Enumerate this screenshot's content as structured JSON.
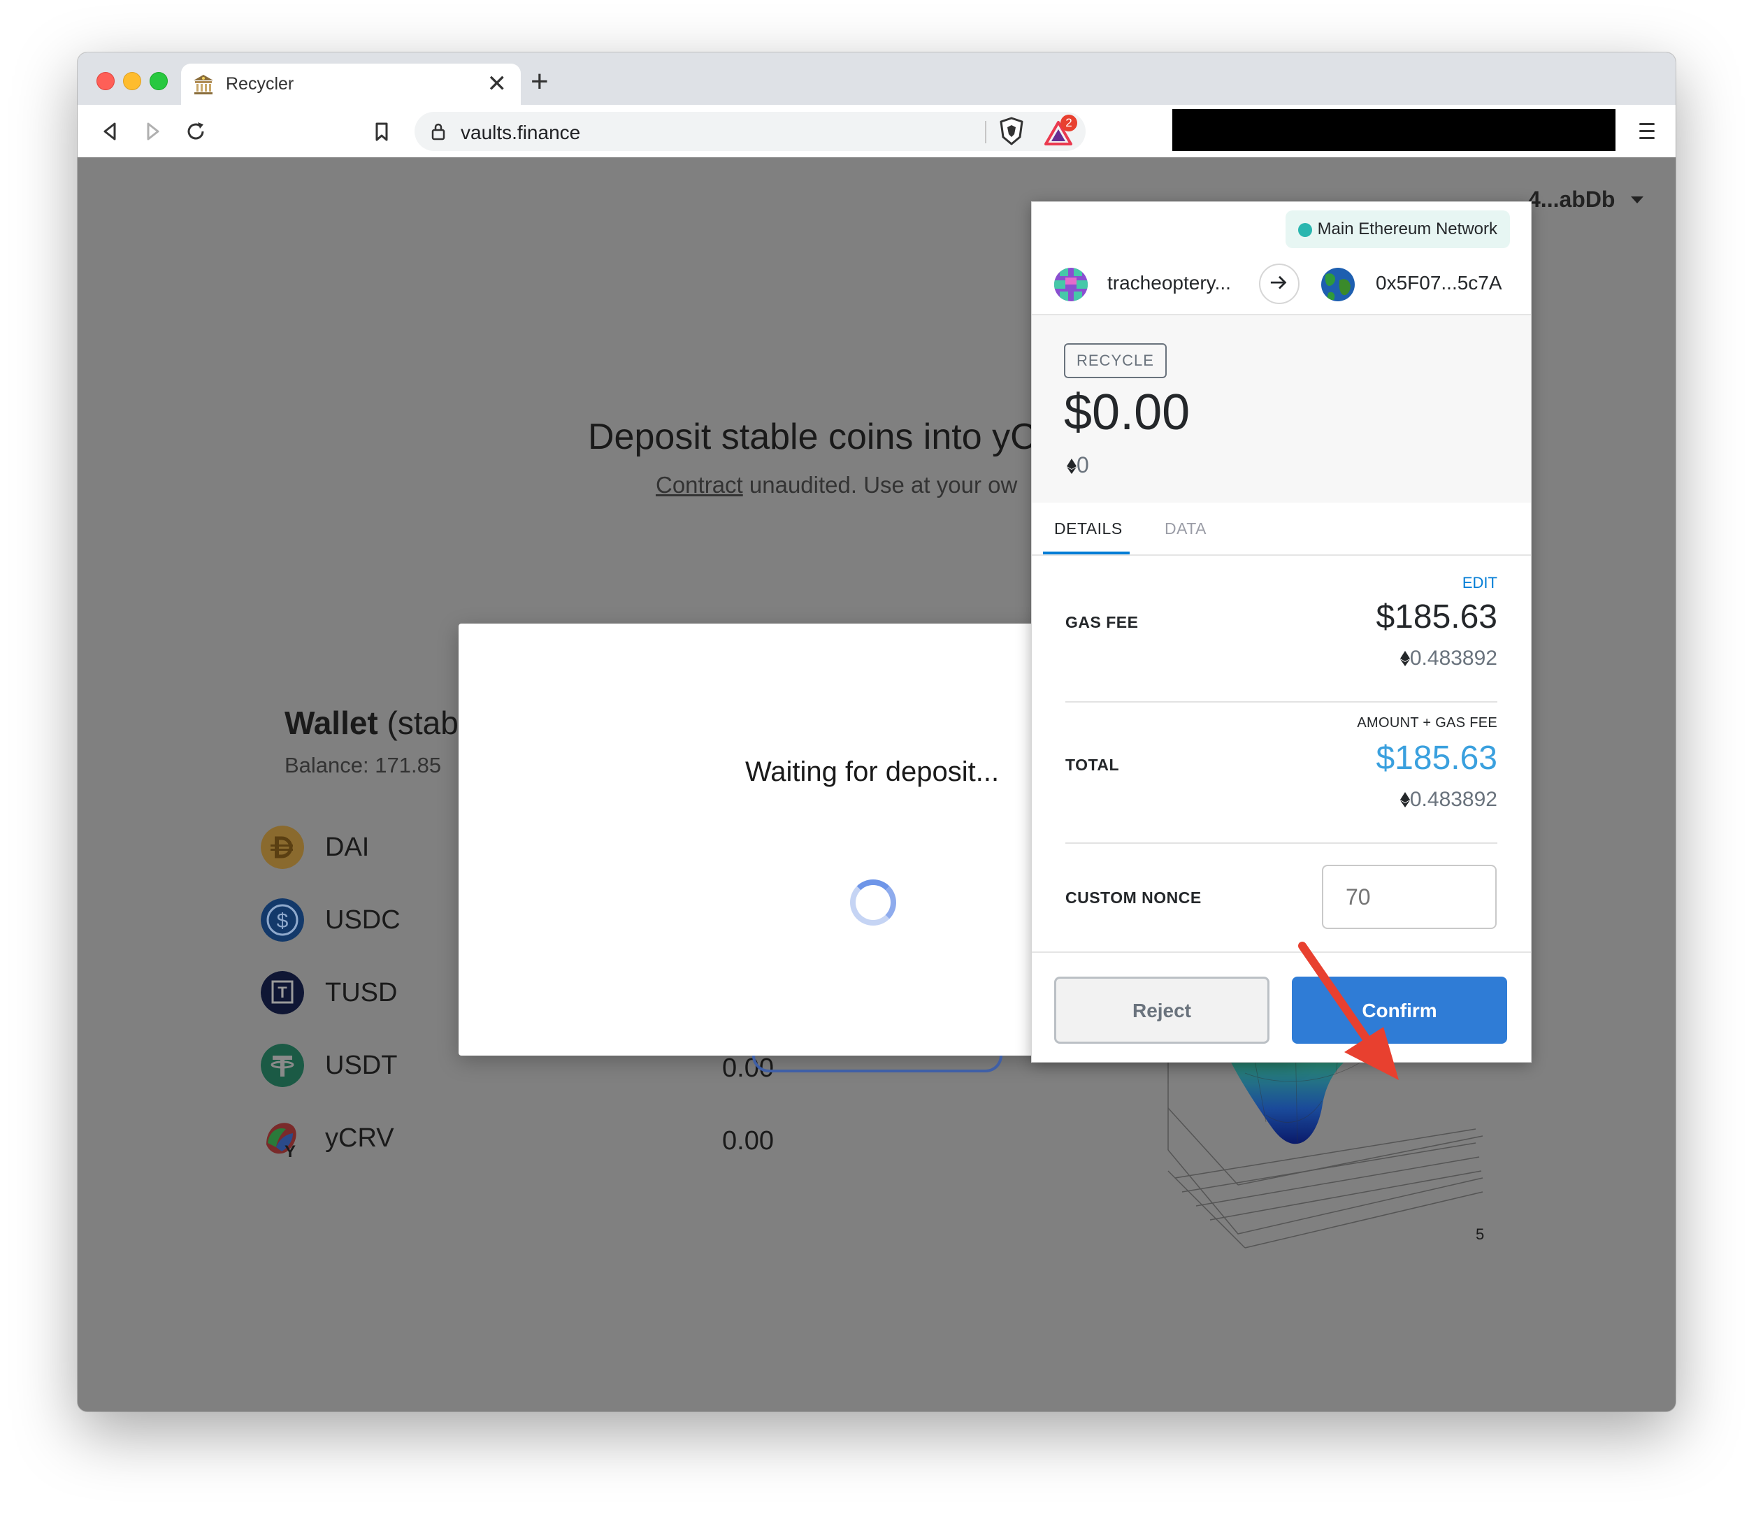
{
  "browser": {
    "tab_title": "Recycler",
    "tab_close": "✕",
    "new_tab": "+",
    "url": "vaults.finance",
    "shield_badge_count": "2"
  },
  "page": {
    "account": "4...abDb",
    "title": "Deposit stable coins into yC",
    "subtitle_link": "Contract",
    "subtitle_rest": " unaudited. Use at your ow",
    "wallet_title_bold": "Wallet",
    "wallet_title_rest": " (stab",
    "wallet_balance": "Balance: 171.85",
    "coins": [
      {
        "name": "DAI",
        "value": "",
        "color": "#f5ac37"
      },
      {
        "name": "USDC",
        "value": "",
        "color": "#2775ca"
      },
      {
        "name": "TUSD",
        "value": "",
        "color": "#1a2a6c"
      },
      {
        "name": "USDT",
        "value": "0.00",
        "color": "#26a17b"
      },
      {
        "name": "yCRV",
        "value": "0.00",
        "color": "#e84142"
      }
    ],
    "plot_tick": "5"
  },
  "modal": {
    "status": "Waiting for deposit..."
  },
  "metamask": {
    "network": "Main Ethereum Network",
    "from_account": "tracheoptery...",
    "to_account": "0x5F07...5c7A",
    "method": "RECYCLE",
    "amount_usd": "$0.00",
    "amount_eth": "0",
    "tabs": [
      {
        "label": "DETAILS",
        "active": true
      },
      {
        "label": "DATA",
        "active": false
      }
    ],
    "edit_label": "EDIT",
    "gas_fee_label": "GAS FEE",
    "gas_fee_usd": "$185.63",
    "gas_fee_eth": "0.483892",
    "total_hint": "AMOUNT + GAS FEE",
    "total_label": "TOTAL",
    "total_usd": "$185.63",
    "total_eth": "0.483892",
    "custom_nonce_label": "CUSTOM NONCE",
    "custom_nonce_placeholder": "70",
    "reject_label": "Reject",
    "confirm_label": "Confirm",
    "accent_color": "#2f7cd6"
  }
}
